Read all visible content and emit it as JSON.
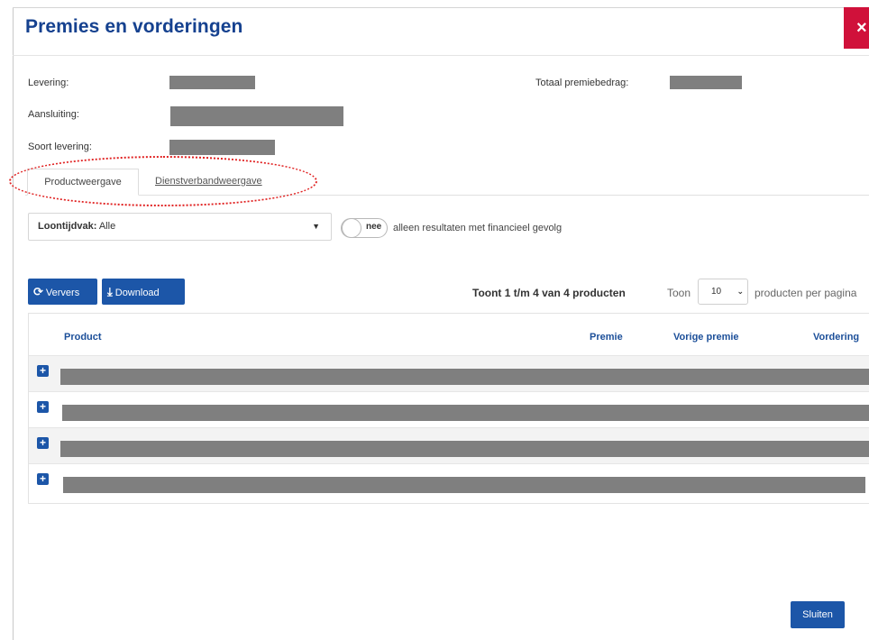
{
  "modal": {
    "title": "Premies en vorderingen",
    "close_label": "×"
  },
  "details": {
    "levering_label": "Levering:",
    "aansluiting_label": "Aansluiting:",
    "soort_levering_label": "Soort levering:",
    "totaal_premiebedrag_label": "Totaal premiebedrag:"
  },
  "tabs": [
    {
      "label": "Productweergave",
      "active": true
    },
    {
      "label": "Dienstverbandweergave",
      "active": false
    }
  ],
  "filter": {
    "loontijdvak_label": "Loontijdvak:",
    "loontijdvak_value": "Alle",
    "toggle_state": "nee",
    "toggle_text": "alleen resultaten met financieel gevolg"
  },
  "toolbar": {
    "refresh_label": "Ververs",
    "download_label": "Download",
    "count_text": "Toont 1 t/m 4 van 4 producten",
    "show_label": "Toon",
    "page_size": "10",
    "per_page_text": "producten per pagina"
  },
  "table": {
    "headers": [
      "Product",
      "Premie",
      "Vorige premie",
      "Vordering"
    ],
    "row_count": 4
  },
  "footer": {
    "close_button": "Sluiten"
  },
  "icons": {
    "refresh": "refresh-icon",
    "download": "download-icon",
    "expand": "plus-icon"
  },
  "colors": {
    "title": "#15418f",
    "primary": "#1c56a8",
    "close": "#d0113a",
    "highlight": "#e02020"
  }
}
